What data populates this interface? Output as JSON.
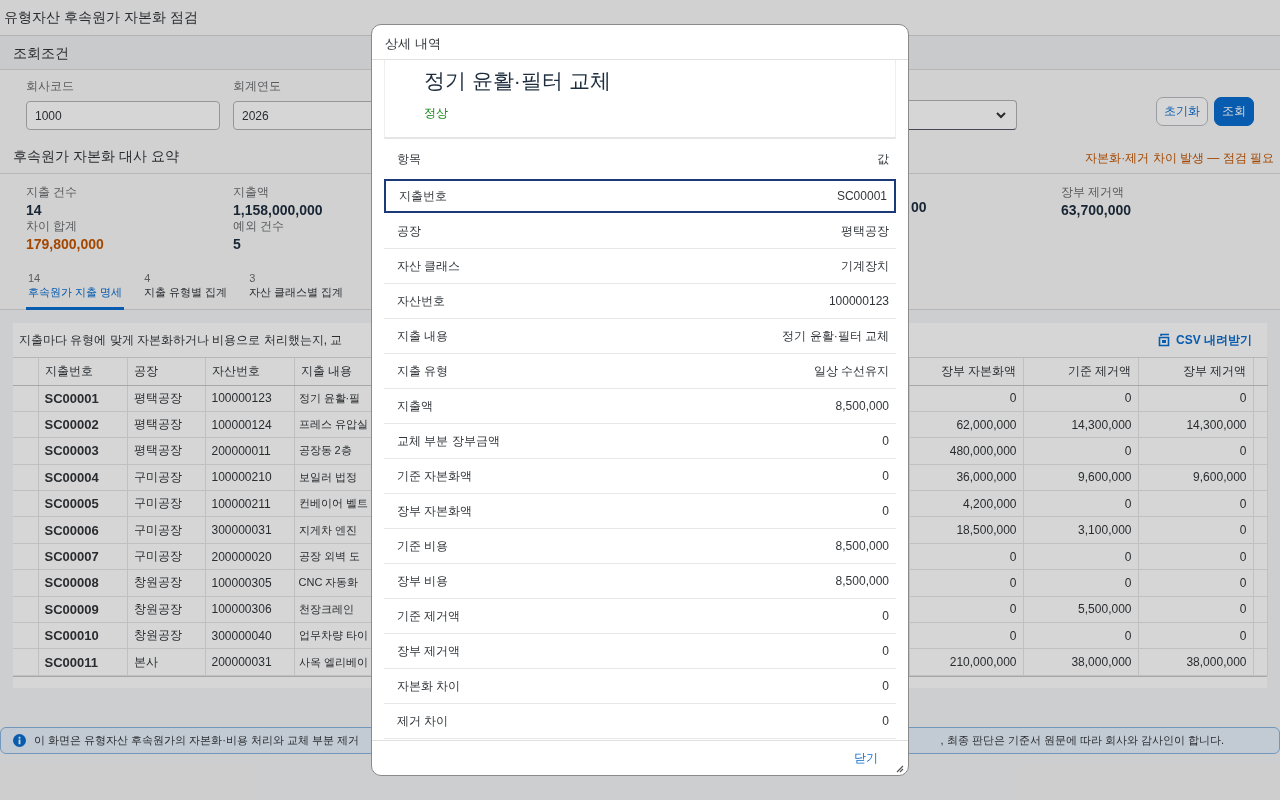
{
  "page": {
    "title": "유형자산 후속원가 자본화 점검"
  },
  "filter_panel": {
    "title": "조회조건",
    "fields": [
      {
        "kind": "input",
        "label": "회사코드",
        "value": "1000"
      },
      {
        "kind": "input",
        "label": "회계연도",
        "value": "2026"
      },
      {
        "kind": "select"
      }
    ],
    "buttons": [
      {
        "label": "초기화",
        "kind": "secondary"
      },
      {
        "label": "조회",
        "kind": "primary"
      }
    ]
  },
  "summary": {
    "title": "후속원가 자본화 대사 요약",
    "alert": "자본화·제거 차이 발생 — 점검 필요",
    "rows": [
      [
        {
          "label": "지출 건수",
          "value": "14",
          "kind": "normal"
        },
        {
          "label": "지출액",
          "value": "1,158,000,000",
          "kind": "normal"
        },
        {
          "value": "00",
          "kind": "normal"
        },
        {
          "label": "장부 제거액",
          "value": "63,700,000",
          "kind": "normal"
        }
      ],
      [
        {
          "label": "차이 합계",
          "value": "179,800,000",
          "kind": "warn"
        },
        {
          "label": "예외 건수",
          "value": "5",
          "kind": "normal"
        }
      ]
    ]
  },
  "tabs": [
    {
      "count": "14",
      "label": "후속원가 지출 명세",
      "selected": true
    },
    {
      "count": "4",
      "label": "지출 유형별 집계",
      "selected": false
    },
    {
      "count": "3",
      "label": "자산 클래스별 집계",
      "selected": false
    }
  ],
  "table": {
    "caption": "지출마다 유형에 맞게 자본화하거나 비용으로 처리했는지, 교",
    "download": "CSV 내려받기",
    "columns": [
      "지출번호",
      "공장",
      "자산번호",
      "지출 내용",
      "장부 자본화액",
      "기준 제거액",
      "장부 제거액"
    ],
    "rows": [
      [
        "SC00001",
        "평택공장",
        "100000123",
        "정기 윤활·필",
        "0",
        "0",
        "0"
      ],
      [
        "SC00002",
        "평택공장",
        "100000124",
        "프레스 유압실",
        "62,000,000",
        "14,300,000",
        "14,300,000"
      ],
      [
        "SC00003",
        "평택공장",
        "200000011",
        "공장동 2층",
        "480,000,000",
        "0",
        "0"
      ],
      [
        "SC00004",
        "구미공장",
        "100000210",
        "보일러 법정",
        "36,000,000",
        "9,600,000",
        "9,600,000"
      ],
      [
        "SC00005",
        "구미공장",
        "100000211",
        "컨베이어 벨트",
        "4,200,000",
        "0",
        "0"
      ],
      [
        "SC00006",
        "구미공장",
        "300000031",
        "지게차 엔진",
        "18,500,000",
        "3,100,000",
        "0"
      ],
      [
        "SC00007",
        "구미공장",
        "200000020",
        "공장 외벽 도",
        "0",
        "0",
        "0"
      ],
      [
        "SC00008",
        "창원공장",
        "100000305",
        "CNC 자동화",
        "0",
        "0",
        "0"
      ],
      [
        "SC00009",
        "창원공장",
        "100000306",
        "천장크레인",
        "0",
        "5,500,000",
        "0"
      ],
      [
        "SC00010",
        "창원공장",
        "300000040",
        "업무차량 타이",
        "0",
        "0",
        "0"
      ],
      [
        "SC00011",
        "본사",
        "200000031",
        "사옥 엘리베이",
        "210,000,000",
        "38,000,000",
        "38,000,000"
      ]
    ]
  },
  "info_bar": {
    "text_left": "이 화면은 유형자산 후속원가의 자본화·비용 처리와 교체 부분 제거",
    "text_right": ", 최종 판단은 기준서 원문에 따라 회사와 감사인이 합니다."
  },
  "dialog": {
    "title": "상세 내역",
    "heading": "정기 윤활·필터 교체",
    "status": {
      "text": "정상",
      "kind": "ok"
    },
    "columns": [
      "항목",
      "값"
    ],
    "rows": [
      {
        "label": "지출번호",
        "value": "SC00001",
        "selected": true
      },
      {
        "label": "공장",
        "value": "평택공장",
        "selected": false
      },
      {
        "label": "자산 클래스",
        "value": "기계장치",
        "selected": false
      },
      {
        "label": "자산번호",
        "value": "100000123",
        "selected": false
      },
      {
        "label": "지출 내용",
        "value": "정기 윤활·필터 교체",
        "selected": false
      },
      {
        "label": "지출 유형",
        "value": "일상 수선유지",
        "selected": false
      },
      {
        "label": "지출액",
        "value": "8,500,000",
        "selected": false
      },
      {
        "label": "교체 부분 장부금액",
        "value": "0",
        "selected": false
      },
      {
        "label": "기준 자본화액",
        "value": "0",
        "selected": false
      },
      {
        "label": "장부 자본화액",
        "value": "0",
        "selected": false
      },
      {
        "label": "기준 비용",
        "value": "8,500,000",
        "selected": false
      },
      {
        "label": "장부 비용",
        "value": "8,500,000",
        "selected": false
      },
      {
        "label": "기준 제거액",
        "value": "0",
        "selected": false
      },
      {
        "label": "장부 제거액",
        "value": "0",
        "selected": false
      },
      {
        "label": "자본화 차이",
        "value": "0",
        "selected": false
      },
      {
        "label": "제거 차이",
        "value": "0",
        "selected": false
      }
    ],
    "close": "닫기"
  }
}
